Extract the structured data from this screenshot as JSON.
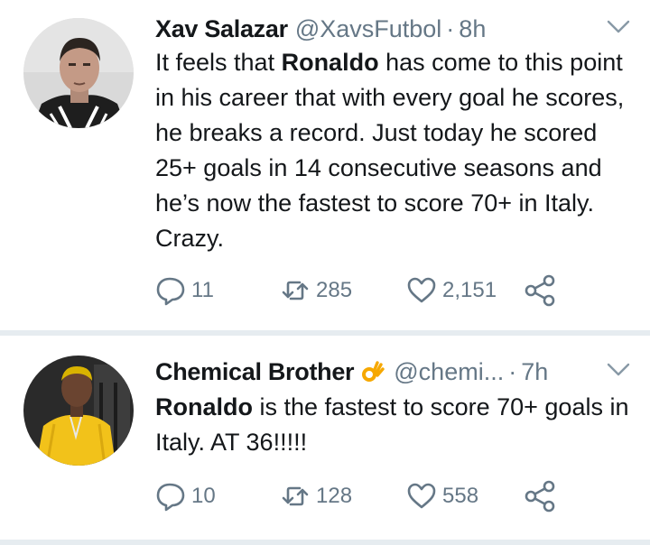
{
  "tweets": [
    {
      "name": "Xav Salazar",
      "handle": "@XavsFutbol",
      "separator": "·",
      "time": "8h",
      "text_bold": "Ronaldo",
      "text_before": "It feels that ",
      "text_after": " has come to this point in his career that with every goal he scores, he breaks a record. Just today he scored 25+ goals in 14 consecutive seasons and he’s now the fastest to score 70+ in Italy. Crazy.",
      "replies": "11",
      "retweets": "285",
      "likes": "2,151"
    },
    {
      "name": "Chemical Brother",
      "handle": "@chemi...",
      "separator": "·",
      "time": "7h",
      "text_bold": "Ronaldo",
      "text_before": "",
      "text_after": " is the fastest to score 70+ goals in Italy. AT 36!!!!!",
      "replies": "10",
      "retweets": "128",
      "likes": "558"
    }
  ],
  "colors": {
    "secondary": "#657786",
    "divider": "#e6ecf0",
    "text": "#14171a"
  },
  "icons": [
    "reply-icon",
    "retweet-icon",
    "like-icon",
    "share-icon",
    "chevron-down-icon",
    "ok-hand-emoji"
  ]
}
